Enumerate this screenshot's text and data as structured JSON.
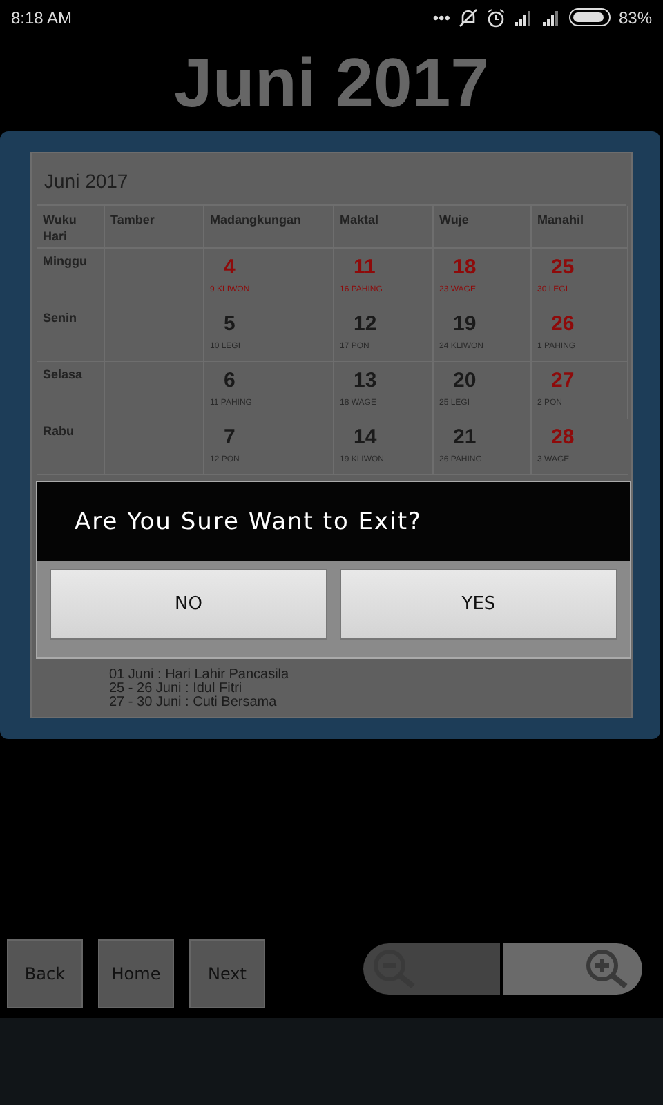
{
  "status_bar": {
    "time": "8:18 AM",
    "more": "•••",
    "battery_text": "83%"
  },
  "title": "Juni 2017",
  "calendar": {
    "title": "Juni 2017",
    "columns": [
      {
        "label": "Wuku\nHari"
      },
      {
        "label": "Tamber"
      },
      {
        "label": "Madangkungan"
      },
      {
        "label": "Maktal"
      },
      {
        "label": "Wuje"
      },
      {
        "label": "Manahil"
      }
    ],
    "rows": [
      {
        "sunday": true,
        "cells": [
          "Minggu",
          "",
          {
            "date": "4",
            "pasaran": "9 KLIWON",
            "holiday": true
          },
          {
            "date": "11",
            "pasaran": "16 PAHING",
            "holiday": true
          },
          {
            "date": "18",
            "pasaran": "23 WAGE",
            "holiday": true
          },
          {
            "date": "25",
            "pasaran": "30 LEGI",
            "holiday": true
          }
        ]
      },
      {
        "sunday": false,
        "cells": [
          "Senin",
          "",
          {
            "date": "5",
            "pasaran": "10 LEGI",
            "holiday": false
          },
          {
            "date": "12",
            "pasaran": "17 PON",
            "holiday": false
          },
          {
            "date": "19",
            "pasaran": "24 KLIWON",
            "holiday": false
          },
          {
            "date": "26",
            "pasaran": "1 PAHING",
            "holiday": true
          }
        ]
      },
      {
        "sunday": false,
        "cells": [
          "Selasa",
          "",
          {
            "date": "6",
            "pasaran": "11 PAHING",
            "holiday": false
          },
          {
            "date": "13",
            "pasaran": "18 WAGE",
            "holiday": false
          },
          {
            "date": "20",
            "pasaran": "25 LEGI",
            "holiday": false
          },
          {
            "date": "27",
            "pasaran": "2 PON",
            "holiday": true
          }
        ]
      },
      {
        "sunday": false,
        "cells": [
          "Rabu",
          "",
          {
            "date": "7",
            "pasaran": "12 PON",
            "holiday": false
          },
          {
            "date": "14",
            "pasaran": "19 KLIWON",
            "holiday": false
          },
          {
            "date": "21",
            "pasaran": "26 PAHING",
            "holiday": false
          },
          {
            "date": "28",
            "pasaran": "3 WAGE",
            "holiday": true
          }
        ]
      }
    ],
    "holidays": [
      "01 Juni : Hari Lahir Pancasila",
      "25 - 26 Juni : Idul Fitri",
      "27 - 30 Juni : Cuti Bersama"
    ]
  },
  "dialog": {
    "message": "Are You Sure Want to Exit?",
    "buttons": [
      "NO",
      "YES"
    ]
  },
  "nav_buttons": [
    "Back",
    "Home",
    "Next"
  ],
  "zoom_buttons": [
    {
      "kind": "out",
      "disabled": true
    },
    {
      "kind": "in",
      "disabled": false
    }
  ]
}
